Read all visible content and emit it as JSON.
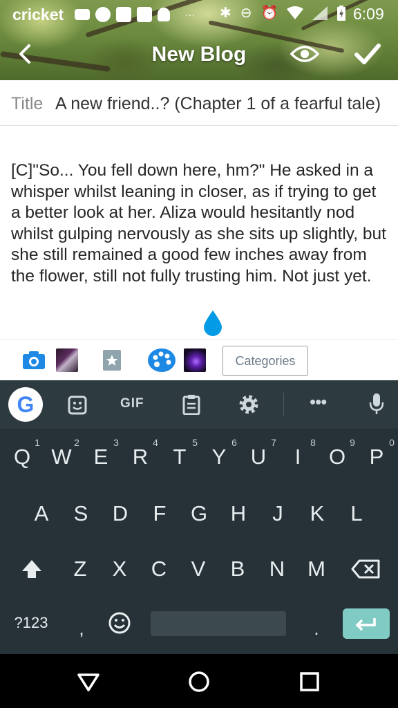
{
  "status_bar": {
    "carrier": "cricket",
    "time": "6:09",
    "icons": [
      "voicemail-icon",
      "messenger-icon",
      "sms-icon",
      "amino-icon",
      "snapchat-icon",
      "more-dots-icon",
      "bluetooth-icon",
      "dnd-icon",
      "alarm-icon",
      "wifi-icon",
      "signal-icon",
      "battery-charging-icon"
    ]
  },
  "app_bar": {
    "title": "New Blog",
    "back_icon": "back-arrow-icon",
    "preview_icon": "eye-icon",
    "submit_icon": "check-icon"
  },
  "title_field": {
    "label": "Title",
    "value": "A new friend..? (Chapter 1 of a fearful tale)"
  },
  "body": {
    "text": "[C]\"So... You fell down here, hm?\" He asked in a whisper whilst leaning in closer, as if trying to get a better look at her. Aliza would hesitantly nod whilst gulping nervously as she sits up slightly, but she still remained a good few inches away from the flower, still not fully trusting him. Not just yet."
  },
  "editor_toolbar": {
    "categories_label": "Categories",
    "icons": [
      "camera-icon",
      "image-thumbnail",
      "sticker-icon",
      "palette-icon",
      "background-thumbnail"
    ]
  },
  "keyboard": {
    "toolbar": {
      "google": "G",
      "gif": "GIF"
    },
    "row1": [
      {
        "key": "Q",
        "hint": "1"
      },
      {
        "key": "W",
        "hint": "2"
      },
      {
        "key": "E",
        "hint": "3"
      },
      {
        "key": "R",
        "hint": "4"
      },
      {
        "key": "T",
        "hint": "5"
      },
      {
        "key": "Y",
        "hint": "6"
      },
      {
        "key": "U",
        "hint": "7"
      },
      {
        "key": "I",
        "hint": "8"
      },
      {
        "key": "O",
        "hint": "9"
      },
      {
        "key": "P",
        "hint": "0"
      }
    ],
    "row2": [
      "A",
      "S",
      "D",
      "F",
      "G",
      "H",
      "J",
      "K",
      "L"
    ],
    "row3": [
      "Z",
      "X",
      "C",
      "V",
      "B",
      "N",
      "M"
    ],
    "row4": {
      "symbols": "?123",
      "comma": ",",
      "period": "."
    }
  },
  "colors": {
    "keyboard_bg": "#263238",
    "enter_key": "#80cbc4",
    "accent_blue": "#1e88e5",
    "droplet": "#039be5"
  }
}
